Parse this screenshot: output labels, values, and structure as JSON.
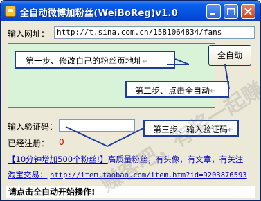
{
  "window": {
    "title": "全自动微博加粉丝(WeiBoReg)v1.0",
    "minimize": "minimize",
    "maximize": "maximize",
    "close": "close"
  },
  "form": {
    "url_label": "输入网址：",
    "url_value": "http://t.sina.com.cn/1581064834/fans",
    "auto_button": "全自动",
    "captcha_label": "输入验证码：",
    "registered_label": "已经注册：",
    "registered_count": "0"
  },
  "callouts": {
    "step1": "第一步、修改自己的粉丝页地址",
    "step2": "第二步、点击全自动",
    "step3": "第三步、输入验证码",
    "pilcrow": "↵"
  },
  "links": {
    "promo_bracket": "【10分钟增加500个粉丝!】",
    "promo_text": "高质量粉丝，有头像，有文章，有关注",
    "taobao_label": "淘宝交易：",
    "taobao_url": "http://item.taobao.com/item.htm?id=9203876593"
  },
  "status_text": "请点击全自动开始操作!",
  "watermark": "赚客吧，有奖一起赚!  www.zuanke8.com",
  "colors": {
    "title_bar": "#0654e2",
    "link": "#0000cc",
    "count": "#c00000",
    "selection": "#d9f3d9"
  }
}
